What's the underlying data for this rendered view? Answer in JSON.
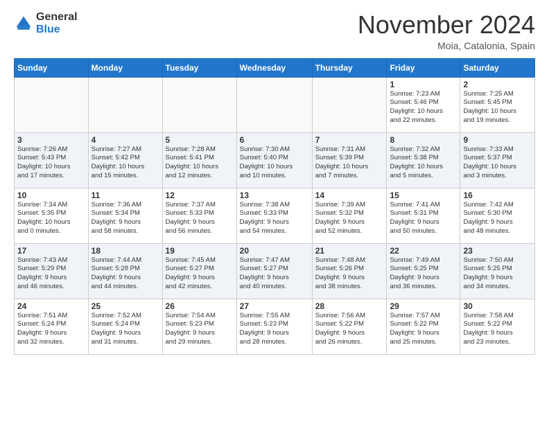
{
  "logo": {
    "general": "General",
    "blue": "Blue"
  },
  "title": "November 2024",
  "location": "Moia, Catalonia, Spain",
  "headers": [
    "Sunday",
    "Monday",
    "Tuesday",
    "Wednesday",
    "Thursday",
    "Friday",
    "Saturday"
  ],
  "weeks": [
    {
      "even": false,
      "days": [
        {
          "date": "",
          "info": ""
        },
        {
          "date": "",
          "info": ""
        },
        {
          "date": "",
          "info": ""
        },
        {
          "date": "",
          "info": ""
        },
        {
          "date": "",
          "info": ""
        },
        {
          "date": "1",
          "info": "Sunrise: 7:23 AM\nSunset: 5:46 PM\nDaylight: 10 hours\nand 22 minutes."
        },
        {
          "date": "2",
          "info": "Sunrise: 7:25 AM\nSunset: 5:45 PM\nDaylight: 10 hours\nand 19 minutes."
        }
      ]
    },
    {
      "even": true,
      "days": [
        {
          "date": "3",
          "info": "Sunrise: 7:26 AM\nSunset: 5:43 PM\nDaylight: 10 hours\nand 17 minutes."
        },
        {
          "date": "4",
          "info": "Sunrise: 7:27 AM\nSunset: 5:42 PM\nDaylight: 10 hours\nand 15 minutes."
        },
        {
          "date": "5",
          "info": "Sunrise: 7:28 AM\nSunset: 5:41 PM\nDaylight: 10 hours\nand 12 minutes."
        },
        {
          "date": "6",
          "info": "Sunrise: 7:30 AM\nSunset: 5:40 PM\nDaylight: 10 hours\nand 10 minutes."
        },
        {
          "date": "7",
          "info": "Sunrise: 7:31 AM\nSunset: 5:39 PM\nDaylight: 10 hours\nand 7 minutes."
        },
        {
          "date": "8",
          "info": "Sunrise: 7:32 AM\nSunset: 5:38 PM\nDaylight: 10 hours\nand 5 minutes."
        },
        {
          "date": "9",
          "info": "Sunrise: 7:33 AM\nSunset: 5:37 PM\nDaylight: 10 hours\nand 3 minutes."
        }
      ]
    },
    {
      "even": false,
      "days": [
        {
          "date": "10",
          "info": "Sunrise: 7:34 AM\nSunset: 5:35 PM\nDaylight: 10 hours\nand 0 minutes."
        },
        {
          "date": "11",
          "info": "Sunrise: 7:36 AM\nSunset: 5:34 PM\nDaylight: 9 hours\nand 58 minutes."
        },
        {
          "date": "12",
          "info": "Sunrise: 7:37 AM\nSunset: 5:33 PM\nDaylight: 9 hours\nand 56 minutes."
        },
        {
          "date": "13",
          "info": "Sunrise: 7:38 AM\nSunset: 5:33 PM\nDaylight: 9 hours\nand 54 minutes."
        },
        {
          "date": "14",
          "info": "Sunrise: 7:39 AM\nSunset: 5:32 PM\nDaylight: 9 hours\nand 52 minutes."
        },
        {
          "date": "15",
          "info": "Sunrise: 7:41 AM\nSunset: 5:31 PM\nDaylight: 9 hours\nand 50 minutes."
        },
        {
          "date": "16",
          "info": "Sunrise: 7:42 AM\nSunset: 5:30 PM\nDaylight: 9 hours\nand 48 minutes."
        }
      ]
    },
    {
      "even": true,
      "days": [
        {
          "date": "17",
          "info": "Sunrise: 7:43 AM\nSunset: 5:29 PM\nDaylight: 9 hours\nand 46 minutes."
        },
        {
          "date": "18",
          "info": "Sunrise: 7:44 AM\nSunset: 5:28 PM\nDaylight: 9 hours\nand 44 minutes."
        },
        {
          "date": "19",
          "info": "Sunrise: 7:45 AM\nSunset: 5:27 PM\nDaylight: 9 hours\nand 42 minutes."
        },
        {
          "date": "20",
          "info": "Sunrise: 7:47 AM\nSunset: 5:27 PM\nDaylight: 9 hours\nand 40 minutes."
        },
        {
          "date": "21",
          "info": "Sunrise: 7:48 AM\nSunset: 5:26 PM\nDaylight: 9 hours\nand 38 minutes."
        },
        {
          "date": "22",
          "info": "Sunrise: 7:49 AM\nSunset: 5:25 PM\nDaylight: 9 hours\nand 36 minutes."
        },
        {
          "date": "23",
          "info": "Sunrise: 7:50 AM\nSunset: 5:25 PM\nDaylight: 9 hours\nand 34 minutes."
        }
      ]
    },
    {
      "even": false,
      "days": [
        {
          "date": "24",
          "info": "Sunrise: 7:51 AM\nSunset: 5:24 PM\nDaylight: 9 hours\nand 32 minutes."
        },
        {
          "date": "25",
          "info": "Sunrise: 7:52 AM\nSunset: 5:24 PM\nDaylight: 9 hours\nand 31 minutes."
        },
        {
          "date": "26",
          "info": "Sunrise: 7:54 AM\nSunset: 5:23 PM\nDaylight: 9 hours\nand 29 minutes."
        },
        {
          "date": "27",
          "info": "Sunrise: 7:55 AM\nSunset: 5:23 PM\nDaylight: 9 hours\nand 28 minutes."
        },
        {
          "date": "28",
          "info": "Sunrise: 7:56 AM\nSunset: 5:22 PM\nDaylight: 9 hours\nand 26 minutes."
        },
        {
          "date": "29",
          "info": "Sunrise: 7:57 AM\nSunset: 5:22 PM\nDaylight: 9 hours\nand 25 minutes."
        },
        {
          "date": "30",
          "info": "Sunrise: 7:58 AM\nSunset: 5:22 PM\nDaylight: 9 hours\nand 23 minutes."
        }
      ]
    }
  ]
}
